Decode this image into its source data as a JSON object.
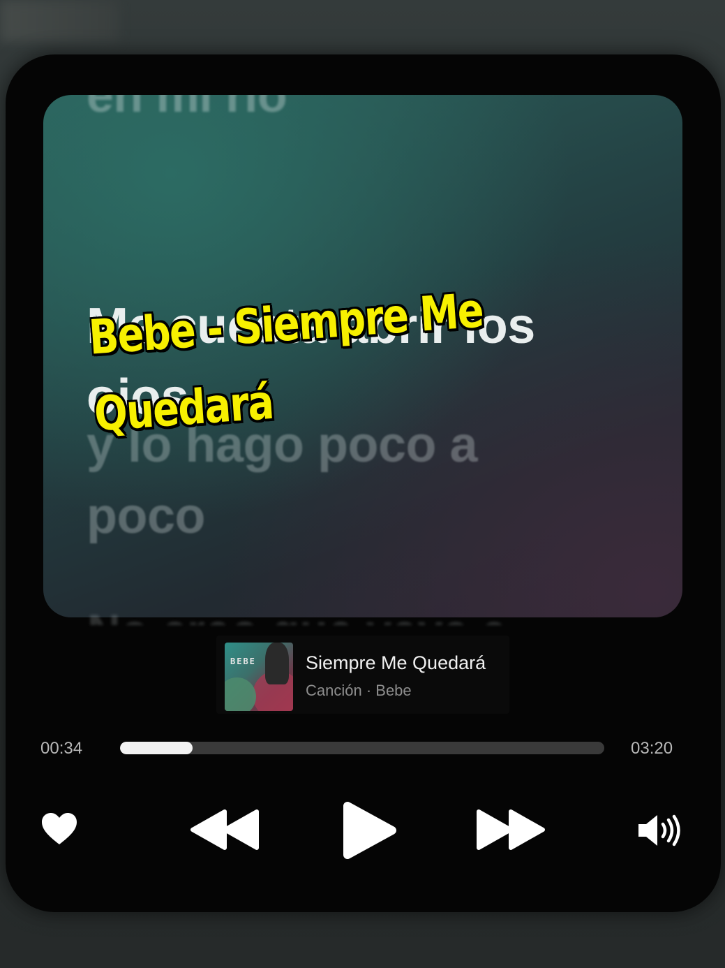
{
  "lyrics": {
    "previous": "en mi río",
    "current": "Me cuesta abrir los ojos",
    "next": "y lo hago poco a poco",
    "after": "No creo que vaya a"
  },
  "overlay": {
    "title": "Bebe - Siempre Me Quedará"
  },
  "track": {
    "title": "Siempre Me Quedará",
    "subtitle": "Canción · Bebe",
    "album_art_text": "BEBE"
  },
  "playback": {
    "elapsed": "00:34",
    "total": "03:20",
    "progress_fraction": 0.15
  },
  "controls": {
    "like_icon": "heart-icon",
    "previous_icon": "rewind-icon",
    "play_icon": "play-icon",
    "next_icon": "fast-forward-icon",
    "volume_icon": "volume-icon"
  },
  "colors": {
    "overlay_text": "#f7f000",
    "accent": "#f2f2f2"
  }
}
